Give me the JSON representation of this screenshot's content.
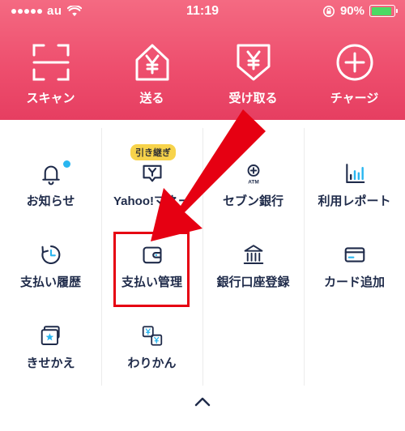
{
  "status_bar": {
    "carrier": "au",
    "time": "11:19",
    "battery_percent": "90%",
    "battery_level": 0.9,
    "icons": [
      "signal-icon",
      "wifi-icon",
      "rotation-lock-icon",
      "battery-icon"
    ]
  },
  "top_actions": [
    {
      "label": "スキャン",
      "icon": "scan-icon"
    },
    {
      "label": "送る",
      "icon": "send-yen-icon"
    },
    {
      "label": "受け取る",
      "icon": "receive-yen-icon"
    },
    {
      "label": "チャージ",
      "icon": "plus-circle-icon"
    }
  ],
  "menu": {
    "row1": [
      {
        "label": "お知らせ",
        "icon": "bell-icon",
        "has_dot": true
      },
      {
        "label": "Yahoo!マネー",
        "icon": "yahoo-money-icon",
        "badge": "引き継ぎ"
      },
      {
        "label": "セブン銀行",
        "icon": "atm-icon",
        "icon_text": "ATM"
      },
      {
        "label": "利用レポート",
        "icon": "bar-chart-icon"
      }
    ],
    "row2": [
      {
        "label": "支払い履歴",
        "icon": "clock-icon"
      },
      {
        "label": "支払い管理",
        "icon": "wallet-icon"
      },
      {
        "label": "銀行口座登録",
        "icon": "bank-icon"
      },
      {
        "label": "カード追加",
        "icon": "credit-card-icon"
      }
    ],
    "row3": [
      {
        "label": "きせかえ",
        "icon": "theme-icon"
      },
      {
        "label": "わりかん",
        "icon": "split-bill-icon"
      }
    ]
  },
  "annotation": {
    "highlight_color": "#e60012",
    "highlighted_item": "支払い管理"
  },
  "colors": {
    "header_top": "#f46a82",
    "header_bottom": "#e63e61",
    "icon_navy": "#1f2b4a",
    "icon_blue": "#29b6f0",
    "badge": "#f7d34b",
    "battery": "#4cd964"
  }
}
